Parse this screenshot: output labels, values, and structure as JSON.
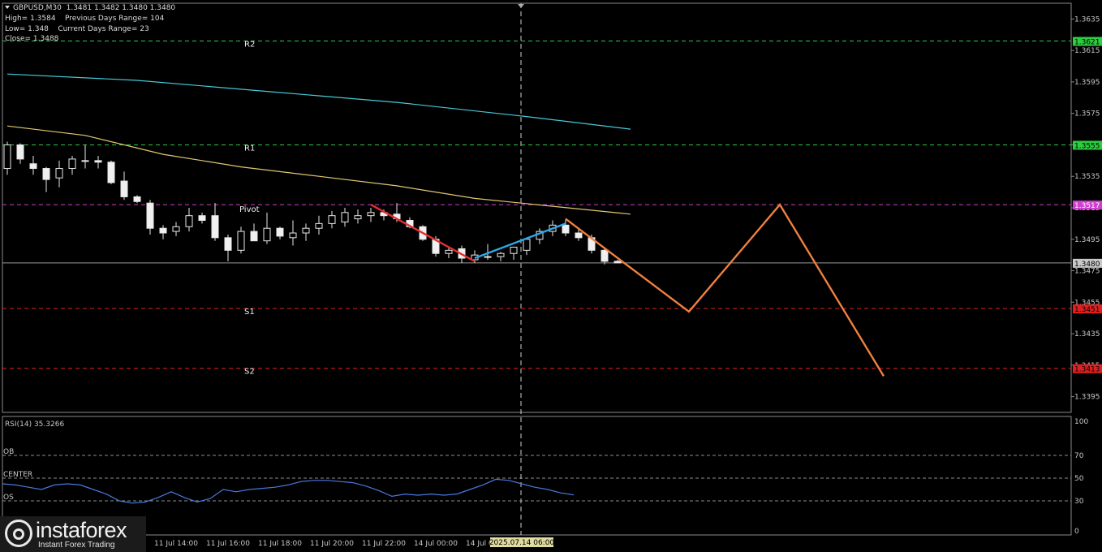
{
  "header": {
    "symbol_line": "GBPUSD,M30  1.3481 1.3482 1.3480 1.3480",
    "high_line": "High= 1.3584    Previous Days Range= 104",
    "low_line": "Low= 1.348    Current Days Range= 23",
    "close_line": "Close= 1.3488"
  },
  "logo": {
    "name": "instaforex",
    "tagline": "Instant Forex Trading"
  },
  "chart_data": [
    {
      "type": "candlestick",
      "symbol": "GBPUSD",
      "timeframe": "M30",
      "ylim": [
        1.3385,
        1.3645
      ],
      "y_ticks": [
        "1.3635",
        "1.3615",
        "1.3595",
        "1.3575",
        "1.3555",
        "1.3535",
        "1.3515",
        "1.3495",
        "1.3475",
        "1.3455",
        "1.3435",
        "1.3415",
        "1.3395"
      ],
      "x_ticks": [
        "11 Jul 14:00",
        "11 Jul 16:00",
        "11 Jul 18:00",
        "11 Jul 20:00",
        "11 Jul 22:00",
        "14 Jul 00:00",
        "14 Jul 02:00",
        "14 Jul"
      ],
      "cursor_label": "2025.07.14 06:00",
      "current_price": {
        "value": 1.348,
        "label": "1.3480",
        "color": "#c8c8c8"
      },
      "levels": [
        {
          "name": "R2",
          "value": 1.3621,
          "label": "1.3621",
          "color": "#2ecc40"
        },
        {
          "name": "R1",
          "value": 1.3555,
          "label": "1.3555",
          "color": "#2ecc40"
        },
        {
          "name": "Pivot",
          "value": 1.3517,
          "label": "1.3517",
          "color": "#d040d0"
        },
        {
          "name": "S1",
          "value": 1.3451,
          "label": "1.3451",
          "color": "#e02020"
        },
        {
          "name": "S2",
          "value": 1.3413,
          "label": "1.3413",
          "color": "#e02020"
        }
      ],
      "candles": [
        [
          1.354,
          1.3557,
          1.3536,
          1.3555
        ],
        [
          1.3555,
          1.3556,
          1.3543,
          1.3546
        ],
        [
          1.3543,
          1.3548,
          1.3536,
          1.354
        ],
        [
          1.354,
          1.3541,
          1.3525,
          1.3533
        ],
        [
          1.3534,
          1.3545,
          1.3528,
          1.354
        ],
        [
          1.354,
          1.3548,
          1.3536,
          1.3546
        ],
        [
          1.3545,
          1.3555,
          1.354,
          1.3545
        ],
        [
          1.3545,
          1.3548,
          1.354,
          1.3544
        ],
        [
          1.3544,
          1.3545,
          1.353,
          1.3531
        ],
        [
          1.3532,
          1.3538,
          1.352,
          1.3522
        ],
        [
          1.3522,
          1.3523,
          1.3518,
          1.3519
        ],
        [
          1.3518,
          1.352,
          1.3498,
          1.3502
        ],
        [
          1.3502,
          1.3504,
          1.3495,
          1.3499
        ],
        [
          1.35,
          1.3506,
          1.3497,
          1.3503
        ],
        [
          1.3503,
          1.3515,
          1.35,
          1.351
        ],
        [
          1.351,
          1.3512,
          1.3505,
          1.3507
        ],
        [
          1.351,
          1.3518,
          1.3494,
          1.3496
        ],
        [
          1.3496,
          1.3498,
          1.3481,
          1.3488
        ],
        [
          1.3488,
          1.3503,
          1.3486,
          1.35
        ],
        [
          1.35,
          1.3505,
          1.3494,
          1.3494
        ],
        [
          1.3494,
          1.3512,
          1.3492,
          1.3502
        ],
        [
          1.3502,
          1.3503,
          1.3495,
          1.3497
        ],
        [
          1.3496,
          1.3507,
          1.3491,
          1.3499
        ],
        [
          1.3499,
          1.3505,
          1.3494,
          1.3502
        ],
        [
          1.3502,
          1.351,
          1.3498,
          1.3505
        ],
        [
          1.3505,
          1.3513,
          1.3502,
          1.351
        ],
        [
          1.3506,
          1.3515,
          1.3503,
          1.3512
        ],
        [
          1.3508,
          1.3514,
          1.3505,
          1.351
        ],
        [
          1.351,
          1.3515,
          1.3506,
          1.3512
        ],
        [
          1.3512,
          1.3514,
          1.3507,
          1.351
        ],
        [
          1.3511,
          1.3518,
          1.3506,
          1.3508
        ],
        [
          1.3507,
          1.3509,
          1.3502,
          1.3503
        ],
        [
          1.3503,
          1.3504,
          1.3494,
          1.3495
        ],
        [
          1.3495,
          1.3497,
          1.3484,
          1.3486
        ],
        [
          1.3486,
          1.349,
          1.3483,
          1.3488
        ],
        [
          1.3489,
          1.3491,
          1.348,
          1.3483
        ],
        [
          1.3482,
          1.3488,
          1.348,
          1.3485
        ],
        [
          1.3484,
          1.3492,
          1.3482,
          1.3484
        ],
        [
          1.3484,
          1.3487,
          1.3481,
          1.3486
        ],
        [
          1.3486,
          1.349,
          1.3482,
          1.349
        ],
        [
          1.3488,
          1.3496,
          1.3485,
          1.3495
        ],
        [
          1.3495,
          1.3502,
          1.3492,
          1.35
        ],
        [
          1.35,
          1.3507,
          1.3497,
          1.3504
        ],
        [
          1.3504,
          1.3508,
          1.3497,
          1.3499
        ],
        [
          1.3499,
          1.3502,
          1.3494,
          1.3496
        ],
        [
          1.3496,
          1.3498,
          1.3486,
          1.3488
        ],
        [
          1.3488,
          1.349,
          1.3479,
          1.3481
        ],
        [
          1.3481,
          1.3482,
          1.348,
          1.348
        ]
      ],
      "moving_averages": [
        {
          "color": "#48c8d8",
          "points": [
            [
              0,
              1.36
            ],
            [
              10,
              1.3596
            ],
            [
              20,
              1.3589
            ],
            [
              30,
              1.3582
            ],
            [
              40,
              1.3573
            ],
            [
              48,
              1.3565
            ]
          ]
        },
        {
          "color": "#e0c870",
          "points": [
            [
              0,
              1.3567
            ],
            [
              6,
              1.3561
            ],
            [
              12,
              1.3549
            ],
            [
              18,
              1.3541
            ],
            [
              24,
              1.3535
            ],
            [
              30,
              1.3529
            ],
            [
              36,
              1.3521
            ],
            [
              42,
              1.3516
            ],
            [
              48,
              1.3511
            ]
          ]
        }
      ],
      "wave_lines": [
        {
          "color": "#e03030",
          "points": [
            [
              28,
              1.3517
            ],
            [
              36,
              1.3481
            ]
          ]
        },
        {
          "color": "#2ea8e8",
          "points": [
            [
              36,
              1.3483
            ],
            [
              43,
              1.3505
            ]
          ]
        },
        {
          "color": "#f08040",
          "points": [
            [
              43,
              1.3508
            ],
            [
              52.5,
              1.3449
            ],
            [
              59.5,
              1.3517
            ],
            [
              67.5,
              1.3408
            ]
          ]
        }
      ]
    },
    {
      "type": "line",
      "title": "RSI(14) 35.3266",
      "ylim": [
        0,
        100
      ],
      "y_ticks": [
        "100",
        "70",
        "50",
        "30",
        "0"
      ],
      "bands": [
        {
          "name": "OB",
          "value": 70
        },
        {
          "name": "CENTER",
          "value": 50
        },
        {
          "name": "OS",
          "value": 30
        }
      ],
      "series": [
        {
          "values": [
            45,
            44,
            42,
            40,
            44,
            45,
            44,
            40,
            36,
            30,
            28,
            29,
            33,
            38,
            33,
            29,
            32,
            40,
            38,
            40,
            41,
            42,
            44,
            47,
            48,
            48,
            47,
            46,
            43,
            39,
            34,
            36,
            35,
            36,
            35,
            36,
            40,
            44,
            49,
            48,
            45,
            42,
            40,
            37,
            35.3
          ]
        }
      ]
    }
  ]
}
